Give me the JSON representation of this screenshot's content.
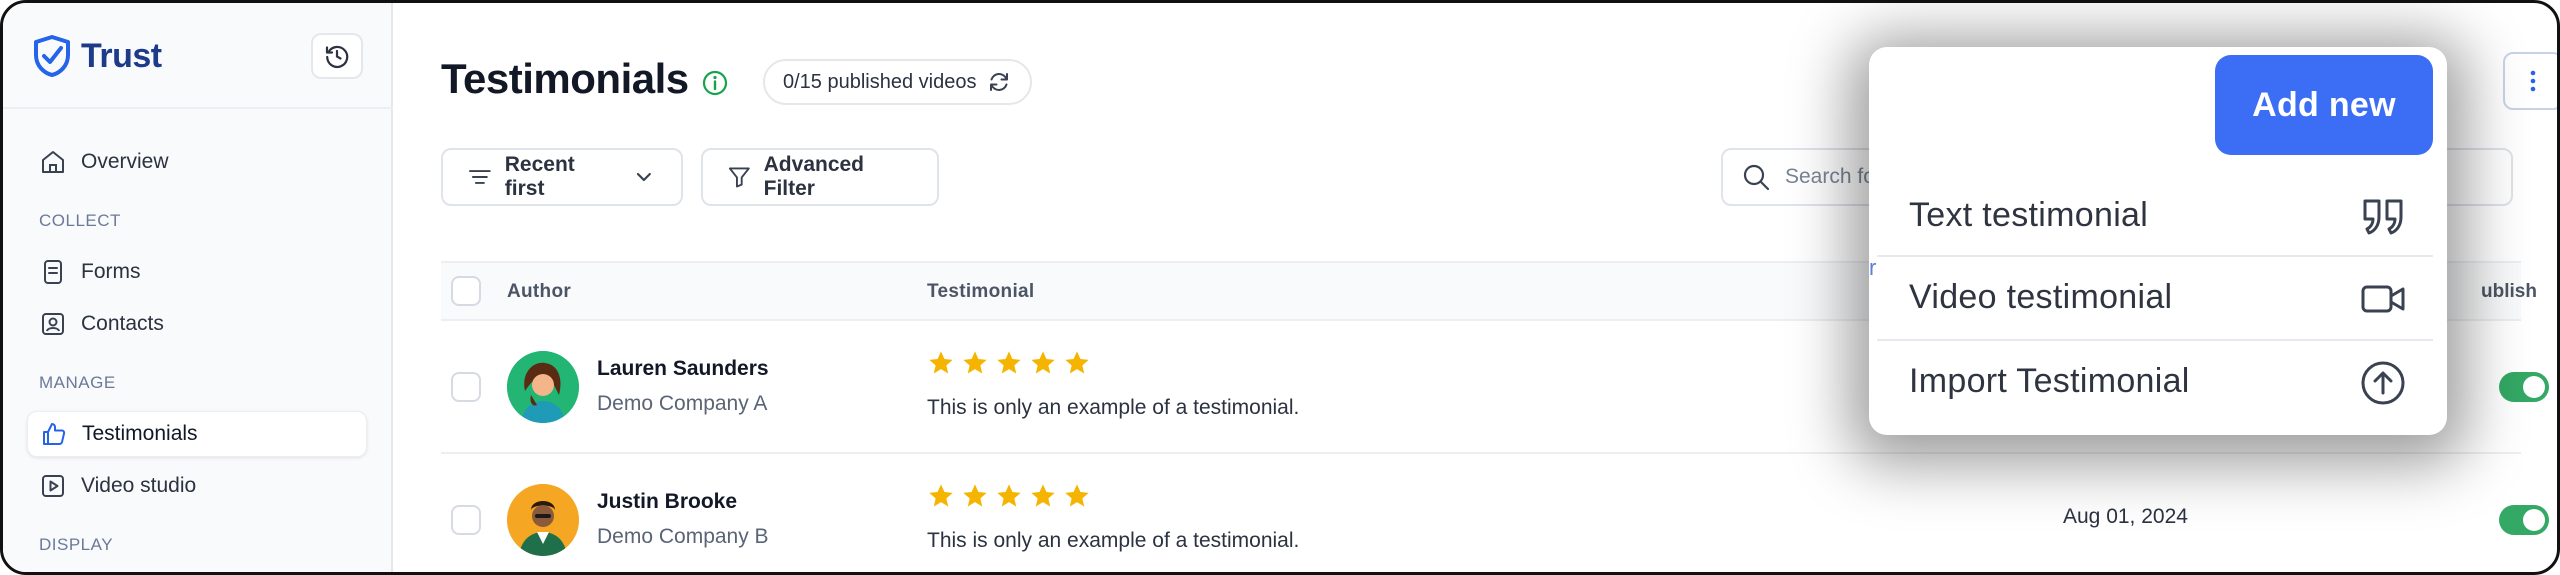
{
  "brand": {
    "name": "Trust"
  },
  "sidebar": {
    "items": [
      {
        "label": "Overview"
      },
      {
        "section": "COLLECT"
      },
      {
        "label": "Forms"
      },
      {
        "label": "Contacts"
      },
      {
        "section": "MANAGE"
      },
      {
        "label": "Testimonials"
      },
      {
        "label": "Video studio"
      },
      {
        "section": "DISPLAY"
      }
    ]
  },
  "header": {
    "title": "Testimonials",
    "published": "0/15 published videos"
  },
  "toolbar": {
    "sort_label": "Recent first",
    "filter_label": "Advanced Filter",
    "search_placeholder": "Search fo"
  },
  "table": {
    "columns": {
      "author": "Author",
      "testimonial": "Testimonial",
      "publish": "ublish"
    },
    "rows": [
      {
        "name": "Lauren Saunders",
        "company": "Demo Company A",
        "rating": 5,
        "text": "This is only an example of a testimonial.",
        "date": "",
        "published": true
      },
      {
        "name": "Justin Brooke",
        "company": "Demo Company B",
        "rating": 5,
        "text": "This is only an example of a testimonial.",
        "date": "Aug 01, 2024",
        "published": true
      }
    ]
  },
  "menu": {
    "add_new": "Add new",
    "items": [
      {
        "label": "Text testimonial",
        "icon": "quote-icon"
      },
      {
        "label": "Video testimonial",
        "icon": "video-camera-icon"
      },
      {
        "label": "Import Testimonial",
        "icon": "upload-circle-icon"
      }
    ],
    "stray_char": "r"
  },
  "colors": {
    "accent": "#3b6ef5",
    "brand": "#1e3a8a",
    "star": "#f5b400",
    "toggle_on": "#34a865"
  }
}
